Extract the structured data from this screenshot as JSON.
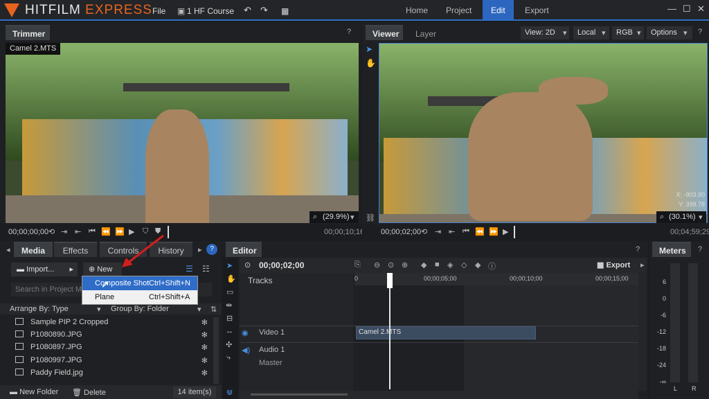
{
  "app": {
    "name_main": "HITFILM",
    "name_sub": "EXPRESS"
  },
  "menubar": {
    "file": "File",
    "project": "1 HF Course"
  },
  "nav": {
    "home": "Home",
    "project": "Project",
    "edit": "Edit",
    "export": "Export"
  },
  "trimmer": {
    "title": "Trimmer",
    "clip": "Camel 2.MTS",
    "zoom": "(29.9%)",
    "time_start": "00;00;00;00",
    "time_end": "00;00;10;16"
  },
  "viewer": {
    "tab_viewer": "Viewer",
    "tab_layer": "Layer",
    "view_select": "View: 2D",
    "local_select": "Local",
    "rgb_select": "RGB",
    "options_label": "Options",
    "zoom": "(30.1%)",
    "coord_x": "X: -903.90",
    "coord_y": "Y: 398.78",
    "time_start": "00;00;02;00",
    "time_end": "00;04;59;29"
  },
  "media_panel": {
    "tabs": [
      "Media",
      "Effects",
      "Controls",
      "History"
    ],
    "import_label": "Import...",
    "new_label": "New",
    "search_placeholder": "Search in Project M",
    "arrange_label": "Arrange By: Type",
    "group_label": "Group By: Folder",
    "items": [
      "Sample PIP 2 Cropped",
      "P1080890.JPG",
      "P1080897.JPG",
      "P1080997.JPG",
      "Paddy Field.jpg"
    ],
    "new_folder_label": "New Folder",
    "delete_label": "Delete",
    "count_label": "14 item(s)"
  },
  "context_menu": {
    "items": [
      {
        "label": "Composite Shot",
        "shortcut": "Ctrl+Shift+N"
      },
      {
        "label": "Plane",
        "shortcut": "Ctrl+Shift+A"
      }
    ]
  },
  "editor": {
    "title": "Editor",
    "timecode": "00;00;02;00",
    "export_label": "Export",
    "tracks_label": "Tracks",
    "ruler": [
      "0",
      "00;00;05;00",
      "00;00;10;00",
      "00;00;15;00"
    ],
    "video_track": "Video 1",
    "clip_name": "Camel 2.MTS",
    "audio_track": "Audio 1",
    "master_label": "Master"
  },
  "meters": {
    "title": "Meters",
    "scale": [
      "6",
      "0",
      "-6",
      "-12",
      "-18",
      "-24",
      "-∞"
    ],
    "left": "L",
    "right": "R"
  },
  "colors": {
    "accent": "#2c66bf",
    "brand": "#e8641e"
  }
}
